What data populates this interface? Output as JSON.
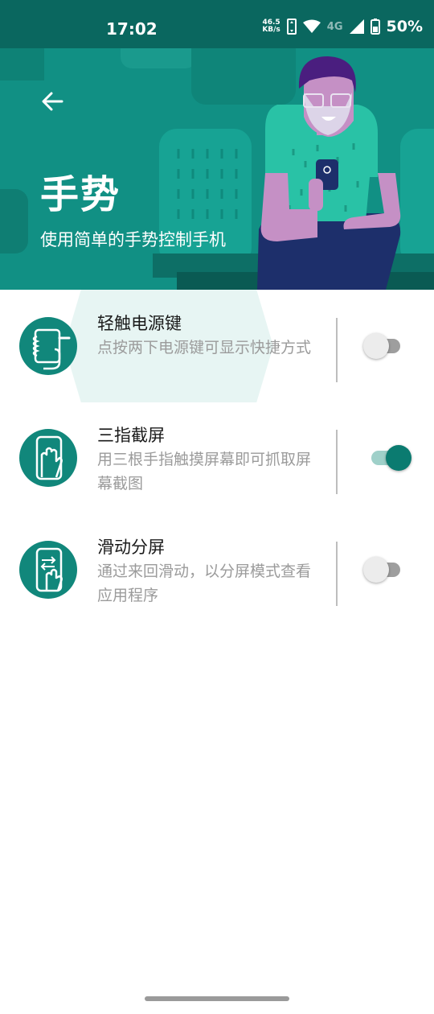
{
  "status_bar": {
    "time": "17:02",
    "net_speed_value": "46.5",
    "net_speed_unit": "KB/s",
    "network_type": "4G",
    "battery_percent": "50%"
  },
  "header": {
    "title": "手势",
    "subtitle": "使用简单的手势控制手机"
  },
  "gestures": [
    {
      "title": "轻触电源键",
      "description": "点按两下电源键可显示快捷方式",
      "enabled": false,
      "icon": "double-tap-power-icon"
    },
    {
      "title": "三指截屏",
      "description": "用三根手指触摸屏幕即可抓取屏幕截图",
      "enabled": true,
      "icon": "three-finger-screenshot-icon"
    },
    {
      "title": "滑动分屏",
      "description": "通过来回滑动，以分屏模式查看应用程序",
      "enabled": false,
      "icon": "swipe-split-screen-icon"
    }
  ],
  "colors": {
    "primary": "#11877b",
    "status_bar": "#0a675f",
    "hero_background": "#119084",
    "toggle_on": "#0b7b70"
  }
}
